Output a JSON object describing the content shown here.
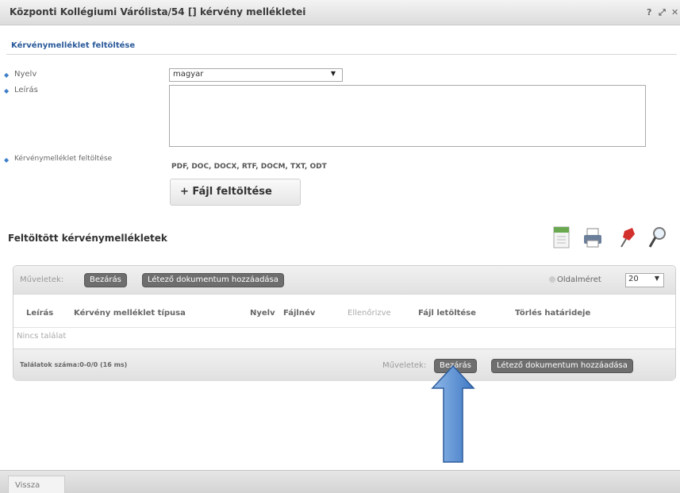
{
  "window": {
    "title": "Központi Kollégiumi Várólista/54 [] kérvény mellékletei",
    "help_glyph": "?",
    "expand_glyph": "⤢",
    "close_glyph": "✕"
  },
  "upload_section": {
    "title": "Kérvénymelléklet feltöltése",
    "language_label": "Nyelv",
    "language_value": "magyar",
    "description_label": "Leírás",
    "upload_label": "Kérvénymelléklet feltöltése",
    "formats": "PDF, DOC, DOCX, RTF, DOCM, TXT, ODT",
    "upload_button": "+ Fájl feltöltése"
  },
  "grid": {
    "title": "Feltöltött kérvénymellékletek",
    "toolbar_icons": [
      "export-icon",
      "print-icon",
      "pin-icon",
      "search-icon"
    ],
    "operations_label": "Műveletek:",
    "close_button": "Bezárás",
    "add_existing_button": "Létező dokumentum hozzáadása",
    "page_size_label": "Oldalméret",
    "page_size_value": "20",
    "columns": [
      "Leírás",
      "Kérvény melléklet típusa",
      "Nyelv",
      "Fájlnév",
      "Ellenőrizve",
      "Fájl letöltése",
      "Törlés határideje"
    ],
    "empty_text": "Nincs találat",
    "footer_count": "Találatok száma:0-0/0 (16 ms)",
    "footer_operations_label": "Műveletek:",
    "footer_close_button": "Bezárás",
    "footer_add_existing_button": "Létező dokumentum hozzáadása"
  },
  "bottom": {
    "back_button": "Vissza"
  },
  "colors": {
    "accent_blue": "#2a5a9a",
    "arrow_blue": "#5b93d6",
    "dark_button": "#6e6e6e"
  }
}
